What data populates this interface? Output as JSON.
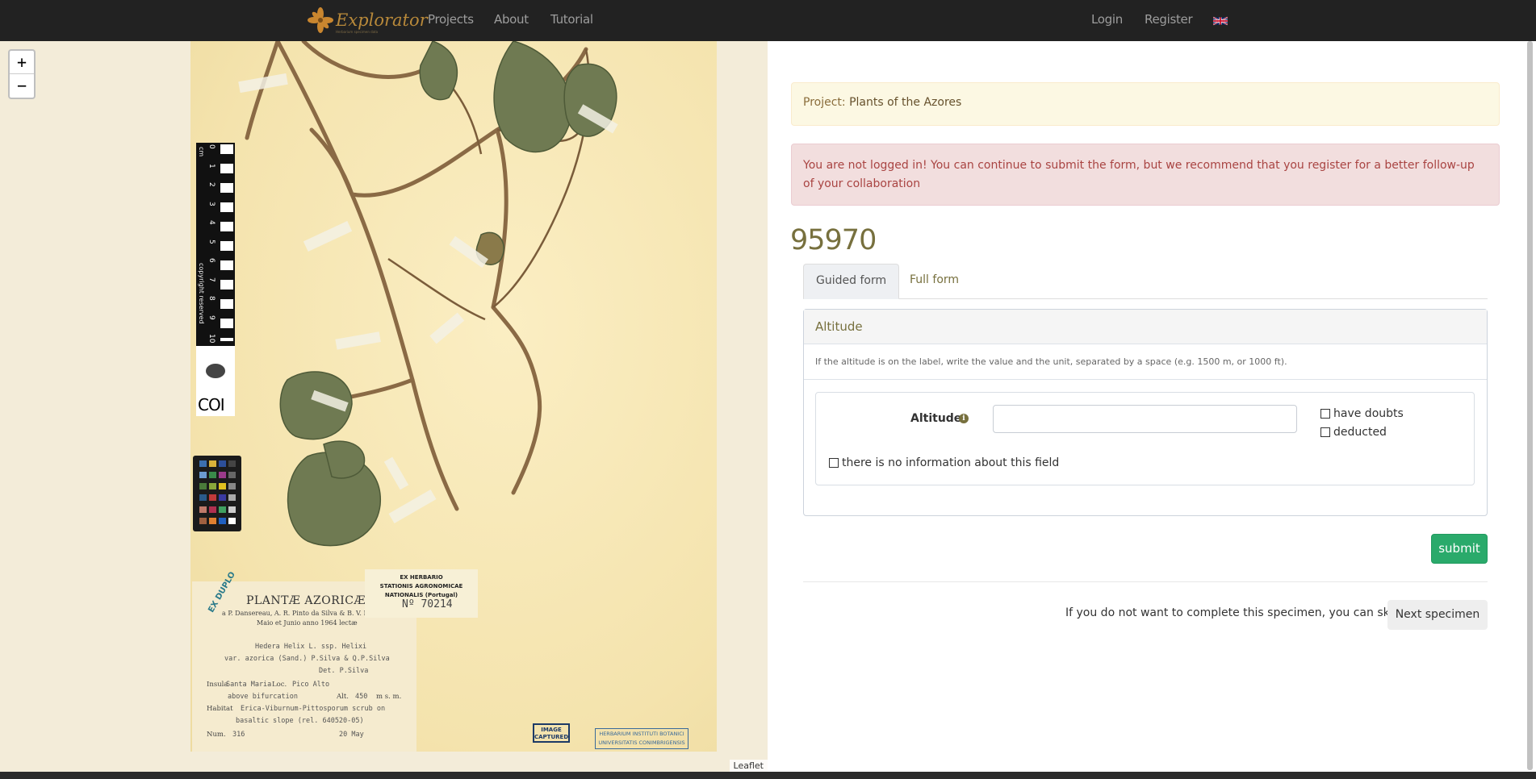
{
  "navbar": {
    "brand": "Explorator",
    "brand_sub": "Herbarium specimen data",
    "links": [
      "Projects",
      "About",
      "Tutorial"
    ],
    "login": "Login",
    "register": "Register",
    "language_flag": "uk-flag-icon"
  },
  "map": {
    "zoom_in": "+",
    "zoom_out": "−",
    "attribution": "Leaflet",
    "specimen_image": {
      "scale_label": "copyright reserved",
      "scale_unit": "cm",
      "scale_numbers": [
        "0",
        "1",
        "2",
        "3",
        "4",
        "5",
        "6",
        "7",
        "8",
        "9",
        "10"
      ],
      "institution": "COI",
      "stamp_ex_duplo": "EX DUPLO",
      "label_title": "PLANTÆ AZORICÆ",
      "label_collectors": "a P. Dansereau, A. R. Pinto da Silva & B. V. Rainha",
      "label_date": "Maio et Junio anno 1964 lectæ",
      "label_lines": [
        "Hedera Helix L. ssp. Helixi",
        "var. azorica (Sand.) P.Silva & Q.P.Silva",
        "Det. P.Silva",
        "Santa Maria",
        "Pico Alto",
        "above bifurcation",
        "Alt.",
        "450",
        "m s. m.",
        "Erica-Viburnum-Pittosporum scrub on",
        "basaltic slope (rel. 640520-05)",
        "Num.",
        "316",
        "20 May"
      ],
      "label_fields": [
        "Insula",
        "Loc.",
        "Habitat"
      ],
      "ex_herbario": [
        "EX HERBARIO",
        "STATIONIS AGRONOMICAE",
        "NATIONALIS (Portugal)"
      ],
      "ex_herbario_num": "Nº 70214",
      "image_captured": "IMAGE CAPTURED",
      "herbarium_stamp": [
        "HERBARIUM INSTITUTI BOTANICI",
        "UNIVERSITATIS CONIMBRIGENSIS"
      ]
    }
  },
  "project_alert": {
    "prefix": "Project:",
    "name": "Plants of the Azores"
  },
  "login_alert": "You are not logged in! You can continue to submit the form, but we recommend that you register for a better follow-up of your collaboration",
  "specimen_id": "95970",
  "tabs": [
    {
      "label": "Guided form",
      "active": true
    },
    {
      "label": "Full form",
      "active": false
    }
  ],
  "panel": {
    "title": "Altitude",
    "help": "If the altitude is on the label, write the value and the unit, separated by a space (e.g. 1500 m, or 1000 ft).",
    "field_label": "Altitude",
    "field_value": "",
    "field_placeholder": "",
    "checkbox_doubts": "have doubts",
    "checkbox_deducted": "deducted",
    "checkbox_no_info": "there is no information about this field"
  },
  "submit": "submit",
  "skip": {
    "text": "If you do not want to complete this specimen, you can skip to",
    "button": "Next specimen"
  },
  "colors": {
    "navbar_bg": "#222222",
    "accent_olive": "#77703e",
    "submit_green": "#2aaa6b",
    "warning_bg": "#fcf8e3",
    "danger_bg": "#f2dede"
  }
}
